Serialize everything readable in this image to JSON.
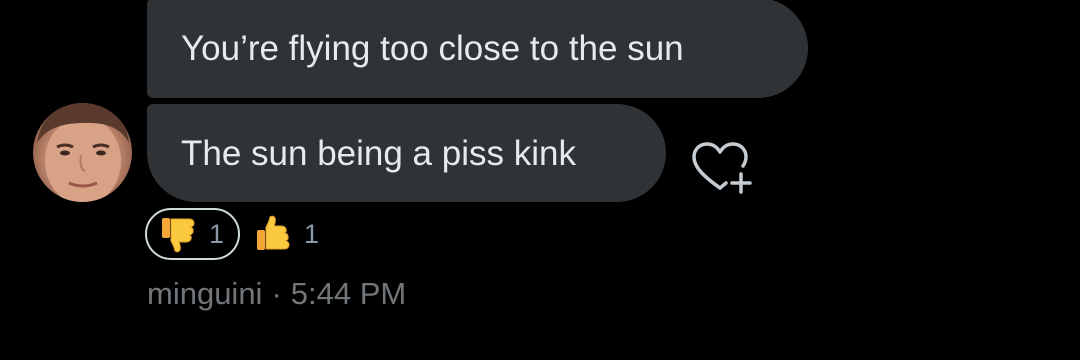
{
  "messages": [
    {
      "text": "You’re flying too close to the sun"
    },
    {
      "text": "The sun being a piss kink"
    }
  ],
  "reactions": [
    {
      "emoji": "thumbs-down",
      "count": "1",
      "selected": true
    },
    {
      "emoji": "thumbs-up",
      "count": "1",
      "selected": false
    }
  ],
  "meta": {
    "sender": "minguini",
    "separator": "·",
    "time": "5:44 PM"
  },
  "colors": {
    "background": "#000000",
    "bubble": "#2f3336",
    "text": "#e7e9ea",
    "muted": "#71767b",
    "emoji_yellow": "#f6c445"
  },
  "icons": {
    "react_button": "heart-plus-icon",
    "avatar": "profile-photo"
  }
}
